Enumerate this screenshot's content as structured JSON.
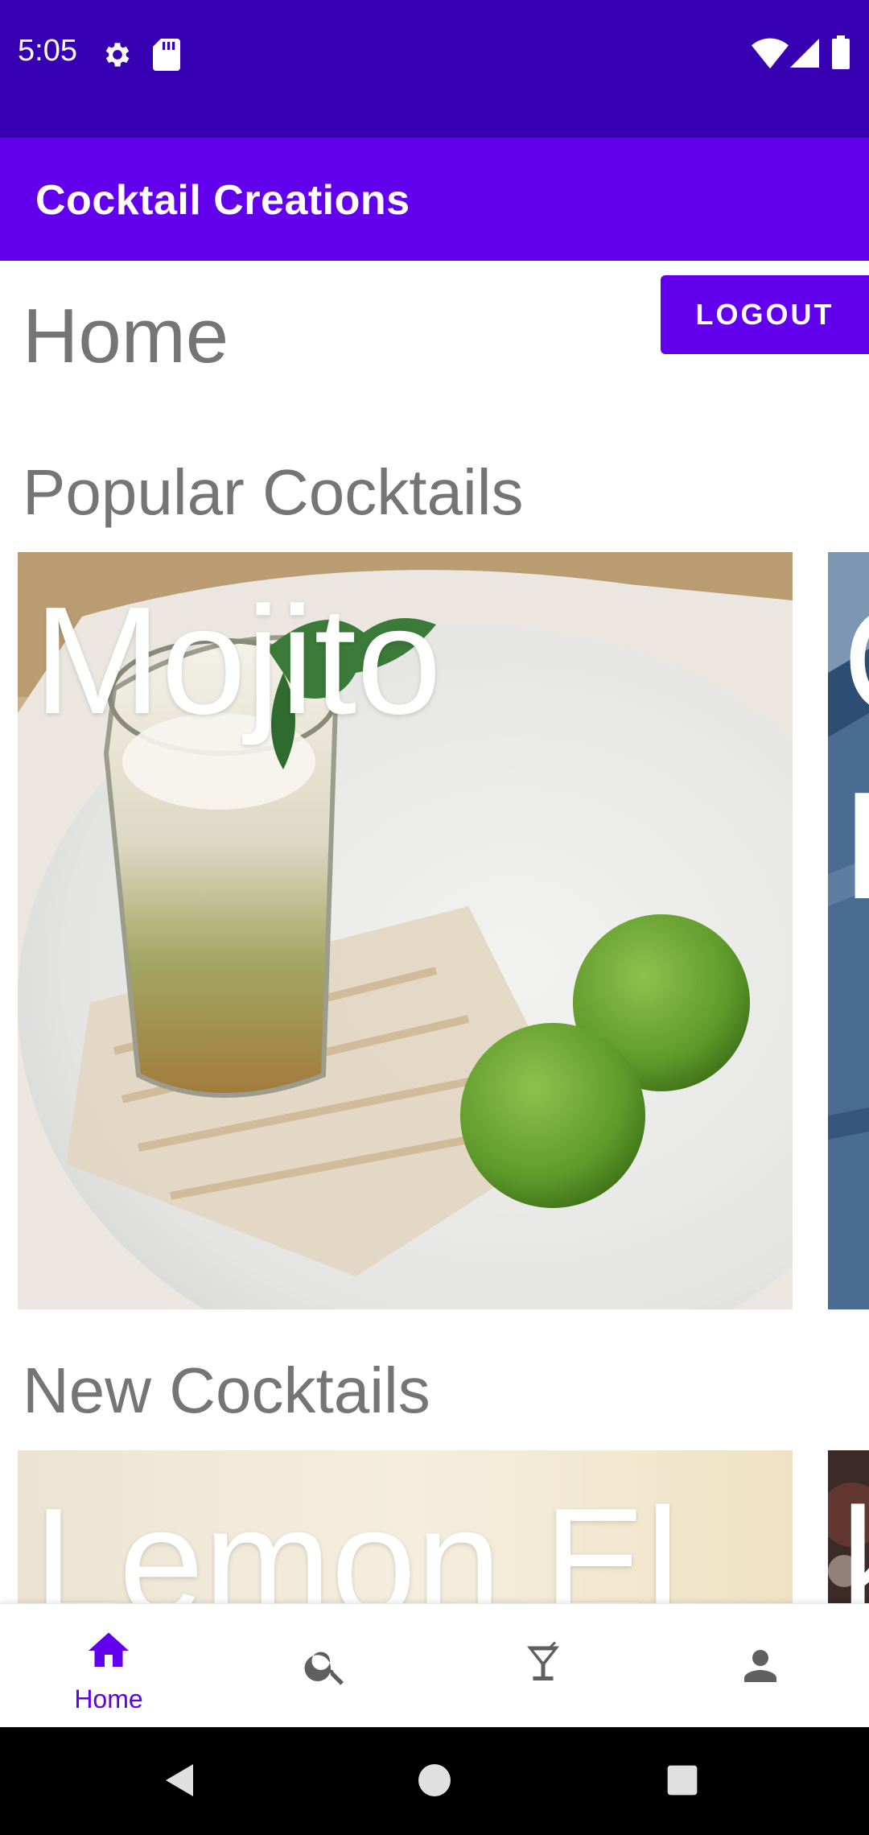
{
  "status_bar": {
    "time": "5:05",
    "background": "#3700b3",
    "left_icons": [
      "settings-icon",
      "sd-card-icon"
    ],
    "right_icons": [
      "wifi-icon",
      "signal-icon",
      "battery-icon"
    ]
  },
  "app_bar": {
    "title": "Cocktail Creations",
    "background": "#6200ee"
  },
  "page": {
    "title": "Home",
    "logout_label": "LOGOUT"
  },
  "sections": {
    "popular": {
      "title": "Popular Cocktails",
      "cards": [
        {
          "label": "Mojito"
        },
        {
          "label": "C\nF"
        }
      ]
    },
    "new": {
      "title": "New Cocktails",
      "cards": [
        {
          "label": "Lemon El"
        },
        {
          "label": "k"
        }
      ]
    }
  },
  "bottom_nav": {
    "items": [
      {
        "label": "Home",
        "icon": "home-icon",
        "selected": true
      },
      {
        "label": "",
        "icon": "search-icon",
        "selected": false
      },
      {
        "label": "",
        "icon": "cocktail-icon",
        "selected": false
      },
      {
        "label": "",
        "icon": "person-icon",
        "selected": false
      }
    ],
    "accent": "#6200ee",
    "inactive": "#5f5f5f"
  },
  "system_nav": {
    "buttons": [
      "back-icon",
      "home-circle-icon",
      "recents-icon"
    ]
  }
}
